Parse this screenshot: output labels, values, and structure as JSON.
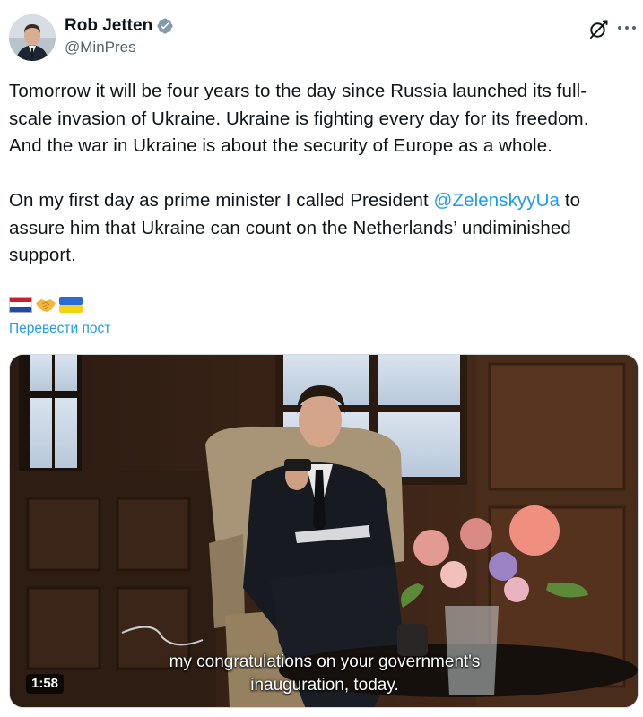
{
  "post": {
    "author": {
      "name": "Rob Jetten",
      "handle": "@MinPres"
    },
    "text_before_mention": "Tomorrow it will be four years to the day since Russia launched its full-scale invasion of Ukraine. Ukraine is fighting every day for its freedom. And the war in Ukraine is about the security of Europe as a whole.",
    "line1": "Tomorrow it will be four years to the day since Russia launched its full-",
    "line2": "scale invasion of Ukraine. Ukraine is fighting every day for its freedom.",
    "line3": "And the war in Ukraine is about the security of Europe as a whole.",
    "para2_prefix": "On my first day as prime minister I called President ",
    "mention": "@ZelenskyyUa",
    "para2_suffix": " to",
    "line5": "assure him that Ukraine can count on the Netherlands’ undiminished",
    "line6": "support.",
    "emoji": [
      "flag-netherlands",
      "handshake",
      "flag-ukraine"
    ],
    "translate_label": "Перевести пост"
  },
  "video": {
    "subtitle_line1": "my congratulations on your government's",
    "subtitle_line2": "inauguration, today.",
    "duration": "1:58"
  },
  "colors": {
    "link": "#1d9bf0",
    "verified": "#829aab",
    "text": "#0f1419",
    "secondary": "#536471"
  }
}
